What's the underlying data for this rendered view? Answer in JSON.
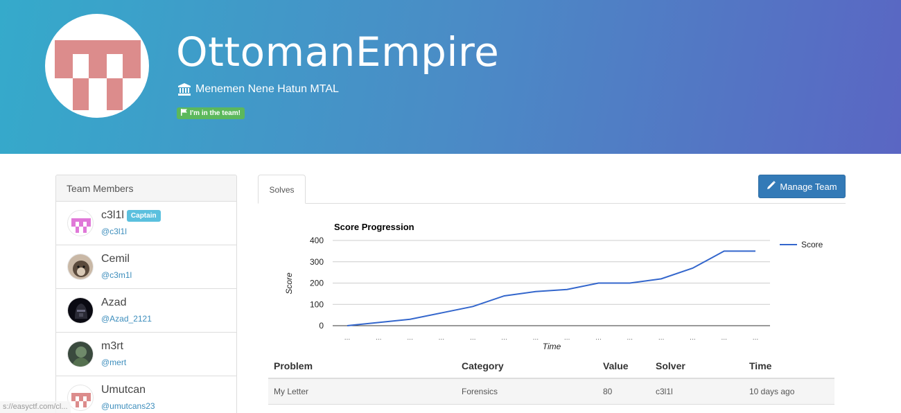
{
  "team": {
    "name": "OttomanEmpire",
    "affiliation": "Menemen Nene Hatun MTAL",
    "in_team_badge": "I'm in the team!",
    "logo_color": "#dc8c8c"
  },
  "members": {
    "header": "Team Members",
    "list": [
      {
        "name": "c3l1l",
        "handle": "@c3l1l",
        "badge": "Captain"
      },
      {
        "name": "Cemil",
        "handle": "@c3m1l"
      },
      {
        "name": "Azad",
        "handle": "@Azad_2121"
      },
      {
        "name": "m3rt",
        "handle": "@mert"
      },
      {
        "name": "Umutcan",
        "handle": "@umutcans23"
      }
    ]
  },
  "tabs": {
    "solves": "Solves"
  },
  "actions": {
    "manage_team": "Manage Team"
  },
  "chart_data": {
    "type": "line",
    "title": "Score Progression",
    "xlabel": "Time",
    "ylabel": "Score",
    "ylim": [
      0,
      400
    ],
    "yticks": [
      0,
      100,
      200,
      300,
      400
    ],
    "xtick_label": "…",
    "grid": true,
    "legend": "right",
    "series": [
      {
        "name": "Score",
        "color": "#3366cc",
        "values": [
          0,
          15,
          30,
          60,
          90,
          140,
          160,
          170,
          200,
          200,
          220,
          270,
          350,
          350
        ]
      }
    ]
  },
  "solves_table": {
    "columns": [
      "Problem",
      "Category",
      "Value",
      "Solver",
      "Time"
    ],
    "rows": [
      [
        "My Letter",
        "Forensics",
        "80",
        "c3l1l",
        "10 days ago"
      ]
    ]
  },
  "status_bar": {
    "url": "s://easyctf.com/cl..."
  }
}
